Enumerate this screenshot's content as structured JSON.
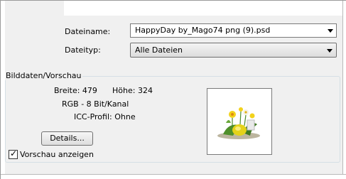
{
  "fields": {
    "filename_label": "Dateiname:",
    "filename_value": "HappyDay by_Mago74 png (9).psd",
    "filetype_label": "Dateityp:",
    "filetype_value": "Alle Dateien"
  },
  "preview_group": {
    "title": "Bilddaten/Vorschau",
    "width_label": "Breite: 479",
    "height_label": "Höhe: 324",
    "color_mode": "RGB - 8 Bit/Kanal",
    "icc_profile": "ICC-Profil: Ohne",
    "details_button": "Details...",
    "preview_checkbox_label": "Vorschau anzeigen",
    "preview_checked": true
  },
  "icons": {
    "dropdown": "chevron-down-icon",
    "checkbox": "checkmark-icon",
    "thumbnail": "easter-flowers-thumbnail"
  },
  "colors": {
    "dialog_bg": "#f0f0f0",
    "field_border": "#7a7a7a"
  }
}
